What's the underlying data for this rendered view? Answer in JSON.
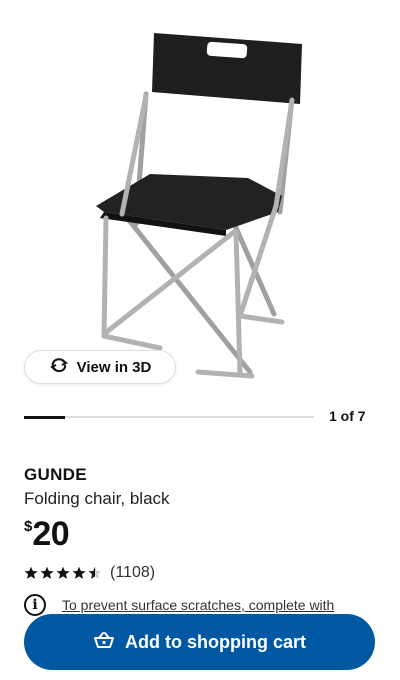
{
  "gallery": {
    "view_3d_label": "View in 3D",
    "pager_text": "1 of 7",
    "current_image": 1,
    "total_images": 7
  },
  "product": {
    "name": "GUNDE",
    "description": "Folding chair, black",
    "currency_symbol": "$",
    "price": "20",
    "rating_stars": 4.5,
    "review_count": "(1108)",
    "info_text": "To prevent surface scratches, complete with"
  },
  "actions": {
    "add_to_cart_label": "Add to shopping cart"
  },
  "icons": {
    "view_3d": "rotate-3d-icon",
    "info": "info-icon",
    "cart": "shopping-basket-icon"
  },
  "colors": {
    "primary_button": "#0058a3",
    "chair_black": "#1e1e1e",
    "frame_silver": "#a9abad"
  }
}
